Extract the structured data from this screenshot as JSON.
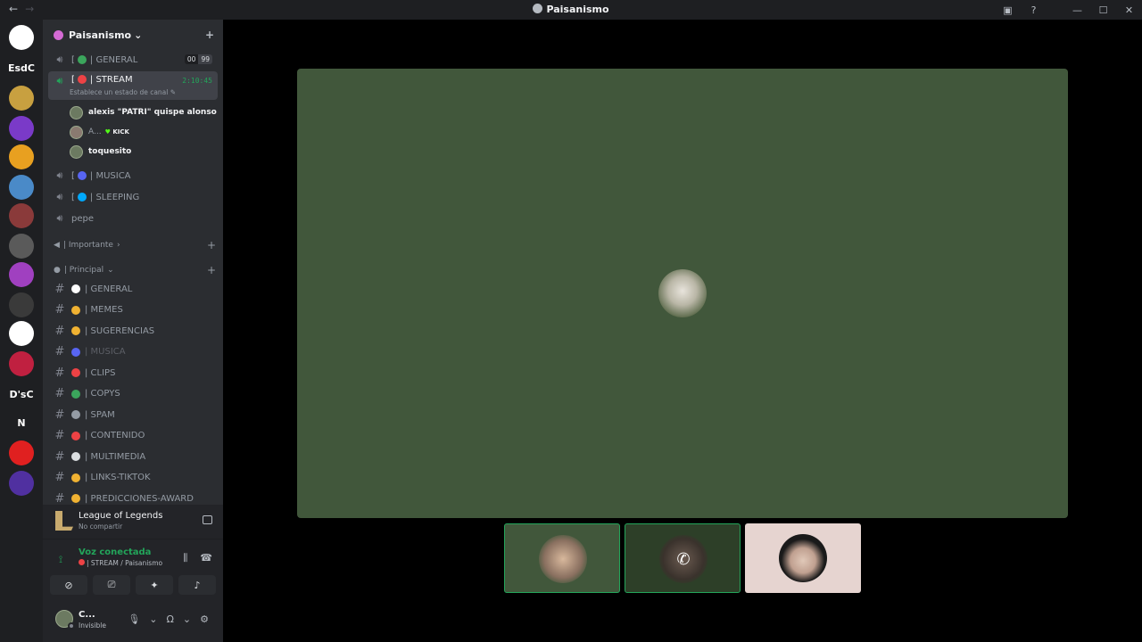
{
  "titlebar": {
    "back": "←",
    "forward": "→",
    "title": "Paisanismo",
    "inbox_icon": "▣",
    "help_icon": "?",
    "minimize": "—",
    "maximize": "☐",
    "close": "✕"
  },
  "guilds": [
    {
      "label": "",
      "color": "#ffffff"
    },
    {
      "label": "EsdC",
      "color": ""
    },
    {
      "label": "",
      "color": "#c8a040"
    },
    {
      "label": "",
      "color": "#7a3ac8"
    },
    {
      "label": "",
      "color": "#e8a020"
    },
    {
      "label": "",
      "color": "#4a8ac8"
    },
    {
      "label": "",
      "color": "#8a3a3a"
    },
    {
      "label": "",
      "color": "#5a5a5a"
    },
    {
      "label": "",
      "color": "#a040c0"
    },
    {
      "label": "",
      "color": "#3a3a3a"
    },
    {
      "label": "",
      "color": "#ffffff"
    },
    {
      "label": "",
      "color": "#c02040"
    },
    {
      "label": "D'sC",
      "color": ""
    },
    {
      "label": "N",
      "color": ""
    },
    {
      "label": "",
      "color": "#e02020"
    },
    {
      "label": "",
      "color": "#5030a0"
    }
  ],
  "server": {
    "name": "Paisanismo",
    "dropdown_icon": "⌄",
    "invite_icon": "+"
  },
  "voice_channels": [
    {
      "name": "| GENERAL",
      "prefix": "[",
      "emoji_color": "#3ba55c",
      "badge1": "00",
      "badge2": "99"
    },
    {
      "name": "| STREAM",
      "prefix": "[",
      "emoji_color": "#ed4245",
      "timer": "2:10:45",
      "subtitle": "Establece un estado de canal ✎"
    },
    {
      "name": "| MUSICA",
      "prefix": "[",
      "emoji_color": "#5865f2"
    },
    {
      "name": "| SLEEPING",
      "prefix": "[",
      "emoji_color": "#00a8fc"
    },
    {
      "name": "pepe",
      "prefix": "",
      "emoji_color": ""
    }
  ],
  "voice_users": [
    {
      "name": "alexis \"PATRI\" quispe alonso",
      "kick": ""
    },
    {
      "name": "A...",
      "kick": "KICK"
    },
    {
      "name": "toquesito",
      "kick": ""
    }
  ],
  "categories": {
    "importante": "| Importante",
    "principal": "| Principal"
  },
  "text_channels": [
    {
      "name": "| GENERAL",
      "emoji_color": "#ffffff",
      "muted": false
    },
    {
      "name": "| MEMES",
      "emoji_color": "#f0b232",
      "muted": false
    },
    {
      "name": "| SUGERENCIAS",
      "emoji_color": "#f0b232",
      "muted": false
    },
    {
      "name": "| MUSICA",
      "emoji_color": "#5865f2",
      "muted": true
    },
    {
      "name": "| CLIPS",
      "emoji_color": "#ed4245",
      "muted": false
    },
    {
      "name": "| COPYS",
      "emoji_color": "#3ba55c",
      "muted": false
    },
    {
      "name": "| SPAM",
      "emoji_color": "#949ba4",
      "muted": false
    },
    {
      "name": "| CONTENIDO",
      "emoji_color": "#ed4245",
      "muted": false
    },
    {
      "name": "| MULTIMEDIA",
      "emoji_color": "#dbdee1",
      "muted": false
    },
    {
      "name": "| LINKS-TIKTOK",
      "emoji_color": "#f0b232",
      "muted": false
    },
    {
      "name": "| PREDICCIONES-AWARD",
      "emoji_color": "#f0b232",
      "muted": false
    }
  ],
  "activity": {
    "game": "League of Legends",
    "status": "No compartir"
  },
  "voice_panel": {
    "title": "Voz conectada",
    "channel": "| STREAM / Paisanismo"
  },
  "user": {
    "name": "C...",
    "status": "Invisible"
  },
  "colors": {
    "main_video_bg": "#41573b",
    "tile1_bg": "#41573b",
    "tile2_bg": "#2d3f28",
    "tile3_bg": "#e6d4d0",
    "speaking_border": "#23a55a"
  }
}
